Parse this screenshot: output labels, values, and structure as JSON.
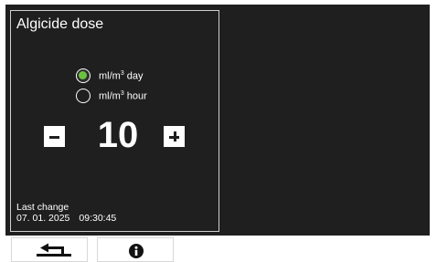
{
  "panel": {
    "title": "Algicide dose"
  },
  "units": {
    "options": [
      {
        "prefix": "ml/m",
        "exponent": "3",
        "suffix": " day",
        "selected": true
      },
      {
        "prefix": "ml/m",
        "exponent": "3",
        "suffix": " hour",
        "selected": false
      }
    ]
  },
  "dose": {
    "value": "10"
  },
  "last_change": {
    "label": "Last change",
    "date": "07. 01. 2025",
    "time": "09:30:45"
  },
  "softkeys": {
    "back_icon": "return-arrow-icon",
    "info_icon": "info-icon"
  },
  "colors": {
    "display_background": "#1f1f1f",
    "selected_radio": "#6cc040",
    "text": "#ffffff"
  }
}
